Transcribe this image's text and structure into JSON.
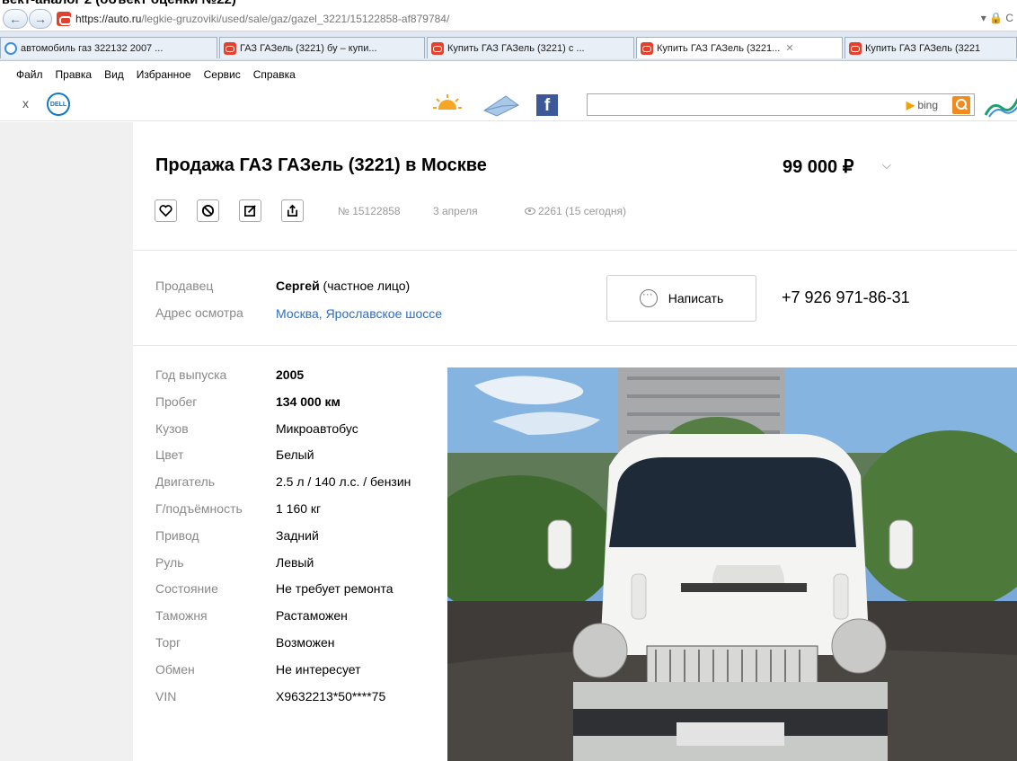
{
  "caption": "ъект-аналог 2 (объект оценки №22)",
  "browser": {
    "url_host": "https://auto.ru",
    "url_path": "/legkie-gruzoviki/used/sale/gaz/gazel_3221/15122858-af879784/",
    "url_tools": "▾ 🔒 C",
    "tabs": [
      {
        "label": "автомобиль газ 322132 2007 ...",
        "icon": "ie-icon",
        "active": false
      },
      {
        "label": "ГАЗ ГАЗель (3221) бу – купи...",
        "icon": "autoru-icon",
        "active": false
      },
      {
        "label": "Купить ГАЗ ГАЗель (3221) с ...",
        "icon": "autoru-icon",
        "active": false
      },
      {
        "label": "Купить ГАЗ ГАЗель (3221...",
        "icon": "autoru-icon",
        "active": true
      },
      {
        "label": "Купить ГАЗ ГАЗель (3221",
        "icon": "autoru-icon",
        "active": false
      }
    ],
    "menu": [
      "Файл",
      "Правка",
      "Вид",
      "Избранное",
      "Сервис",
      "Справка"
    ],
    "toolbar": {
      "close_label": "x",
      "dell_label": "DELL",
      "search_value": "",
      "bing_label": "bing",
      "fb_label": "f"
    }
  },
  "listing": {
    "title": "Продажа ГАЗ ГАЗель (3221) в Москве",
    "price": "99 000 ₽",
    "number": "№ 15122858",
    "date": "3 апреля",
    "views": "2261 (15 сегодня)",
    "seller_label": "Продавец",
    "seller_name": "Сергей",
    "seller_type": " (частное лицо)",
    "address_label": "Адрес осмотра",
    "address_value": "Москва, Ярославское шоссе",
    "write_label": "Написать",
    "phone": "+7 926 971-86-31",
    "specs": [
      {
        "label": "Год выпуска",
        "value": "2005",
        "bold": true
      },
      {
        "label": "Пробег",
        "value": "134 000 км",
        "bold": true
      },
      {
        "label": "Кузов",
        "value": "Микроавтобус",
        "bold": false
      },
      {
        "label": "Цвет",
        "value": "Белый",
        "bold": false
      },
      {
        "label": "Двигатель",
        "value": "2.5 л / 140 л.с. / бензин",
        "bold": false
      },
      {
        "label": "Г/подъёмность",
        "value": "1 160 кг",
        "bold": false
      },
      {
        "label": "Привод",
        "value": "Задний",
        "bold": false
      },
      {
        "label": "Руль",
        "value": "Левый",
        "bold": false
      },
      {
        "label": "Состояние",
        "value": "Не требует ремонта",
        "bold": false
      },
      {
        "label": "Таможня",
        "value": "Растаможен",
        "bold": false
      },
      {
        "label": "Торг",
        "value": "Возможен",
        "bold": false
      },
      {
        "label": "Обмен",
        "value": "Не интересует",
        "bold": false
      },
      {
        "label": "VIN",
        "value": "X9632213*50****75",
        "bold": false
      }
    ]
  }
}
